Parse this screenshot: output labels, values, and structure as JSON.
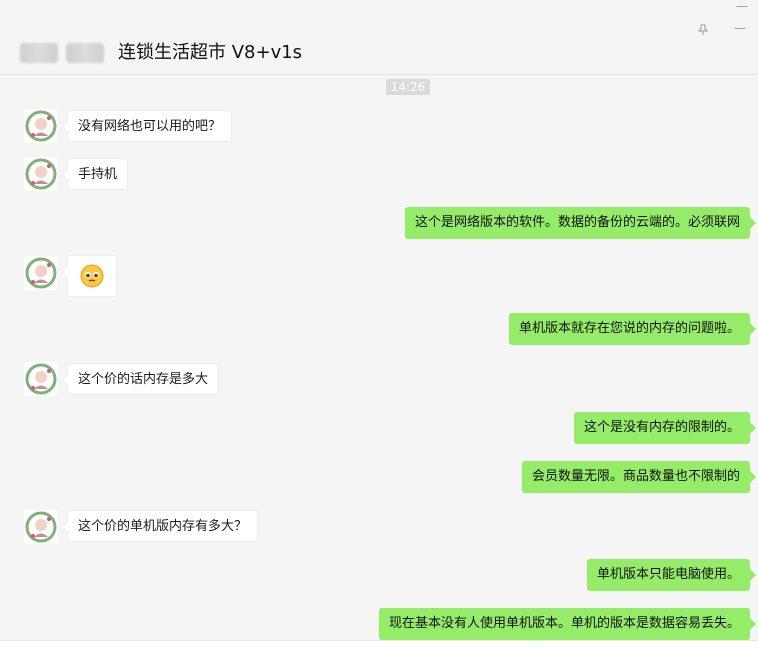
{
  "header": {
    "title": "连锁生活超市 V8+v1s"
  },
  "window": {
    "pin_icon": "pin-icon",
    "minimize_icon": "minimize-icon",
    "close_icon": "close-icon"
  },
  "timestamp": "14:26",
  "messages": [
    {
      "side": "in",
      "text": "没有网络也可以用的吧？"
    },
    {
      "side": "in",
      "text": "手持机"
    },
    {
      "side": "out",
      "text": "这个是网络版本的软件。数据的备份的云端的。必须联网"
    },
    {
      "side": "in",
      "type": "emoji",
      "emoji": "🥺"
    },
    {
      "side": "out",
      "text": "单机版本就存在您说的内存的问题啦。"
    },
    {
      "side": "in",
      "text": "这个价的话内存是多大"
    },
    {
      "side": "out",
      "text": "这个是没有内存的限制的。"
    },
    {
      "side": "out",
      "text": "会员数量无限。商品数量也不限制的"
    },
    {
      "side": "in",
      "text": "这个价的单机版内存有多大？"
    },
    {
      "side": "out",
      "text": "单机版本只能电脑使用。"
    },
    {
      "side": "out",
      "text": "现在基本没有人使用单机版本。单机的版本是数据容易丢失。"
    }
  ],
  "colors": {
    "background": "#f5f5f5",
    "outgoing_bubble": "#95ec69",
    "incoming_bubble": "#ffffff",
    "timestamp_bg": "#dadada"
  }
}
